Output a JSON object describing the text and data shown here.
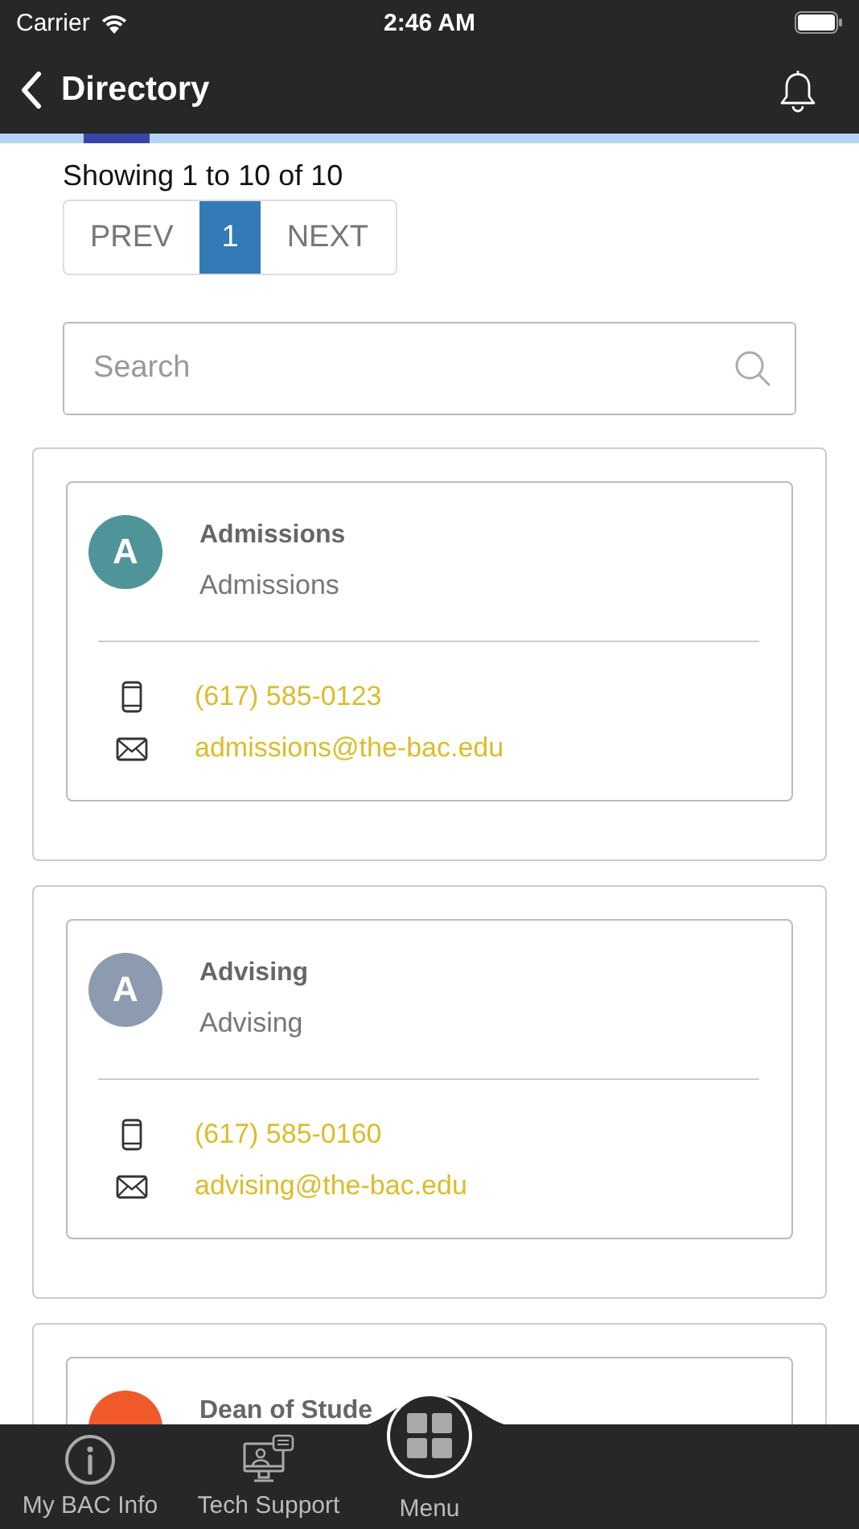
{
  "status_bar": {
    "carrier": "Carrier",
    "time": "2:46 AM"
  },
  "nav": {
    "title": "Directory"
  },
  "summary": "Showing 1 to 10 of 10",
  "pagination": [
    {
      "label": "PREV",
      "selected": false
    },
    {
      "label": "1",
      "selected": true
    },
    {
      "label": "NEXT",
      "selected": false
    }
  ],
  "search": {
    "placeholder": "Search"
  },
  "contacts": [
    {
      "initial": "A",
      "color": "#4f9499",
      "name": "Admissions",
      "department": "Admissions",
      "phone": "(617) 585-0123",
      "email": "admissions@the-bac.edu"
    },
    {
      "initial": "A",
      "color": "#8d9bb0",
      "name": "Advising",
      "department": "Advising",
      "phone": "(617) 585-0160",
      "email": "advising@the-bac.edu"
    },
    {
      "color": "#f05a2b",
      "name": "Dean of Stude"
    }
  ],
  "tab_bar": [
    {
      "kind": "info",
      "label": "My BAC Info"
    },
    {
      "kind": "support",
      "label": "Tech Support"
    },
    {
      "kind": "menu",
      "label": "Menu"
    }
  ]
}
